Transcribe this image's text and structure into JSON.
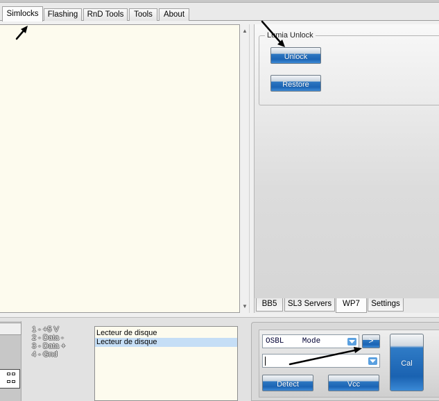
{
  "tabs": [
    {
      "label": "Simlocks",
      "active": true
    },
    {
      "label": "Flashing",
      "active": false
    },
    {
      "label": "RnD Tools",
      "active": false
    },
    {
      "label": "Tools",
      "active": false
    },
    {
      "label": "About",
      "active": false
    }
  ],
  "lumia_unlock": {
    "title": "Lumia Unlock",
    "unlock_label": "Unlock",
    "restore_label": "Restore"
  },
  "sub_tabs": [
    {
      "label": "BB5",
      "active": false
    },
    {
      "label": "SL3 Servers",
      "active": false
    },
    {
      "label": "WP7",
      "active": true
    },
    {
      "label": "Settings",
      "active": false
    }
  ],
  "usb_pins": [
    "1 - +5 V",
    "2 - Data -",
    "3 - Data +",
    "4 - Gnd"
  ],
  "devices": [
    {
      "label": "Lecteur de disque",
      "selected": false
    },
    {
      "label": "Lecteur de disque",
      "selected": true
    }
  ],
  "tool": {
    "mode_select": "OSBL    Mode",
    "go_label": ">",
    "port_value": "",
    "detect_label": "Detect",
    "vcc_label": "Vcc",
    "cal_label": "Cal"
  },
  "colors": {
    "text_area_bg": "#fdfbee",
    "button_blue": "#1b64b4",
    "selection": "#c5def6"
  },
  "icons": {
    "scroll_up": "▲",
    "scroll_down": "▼"
  }
}
